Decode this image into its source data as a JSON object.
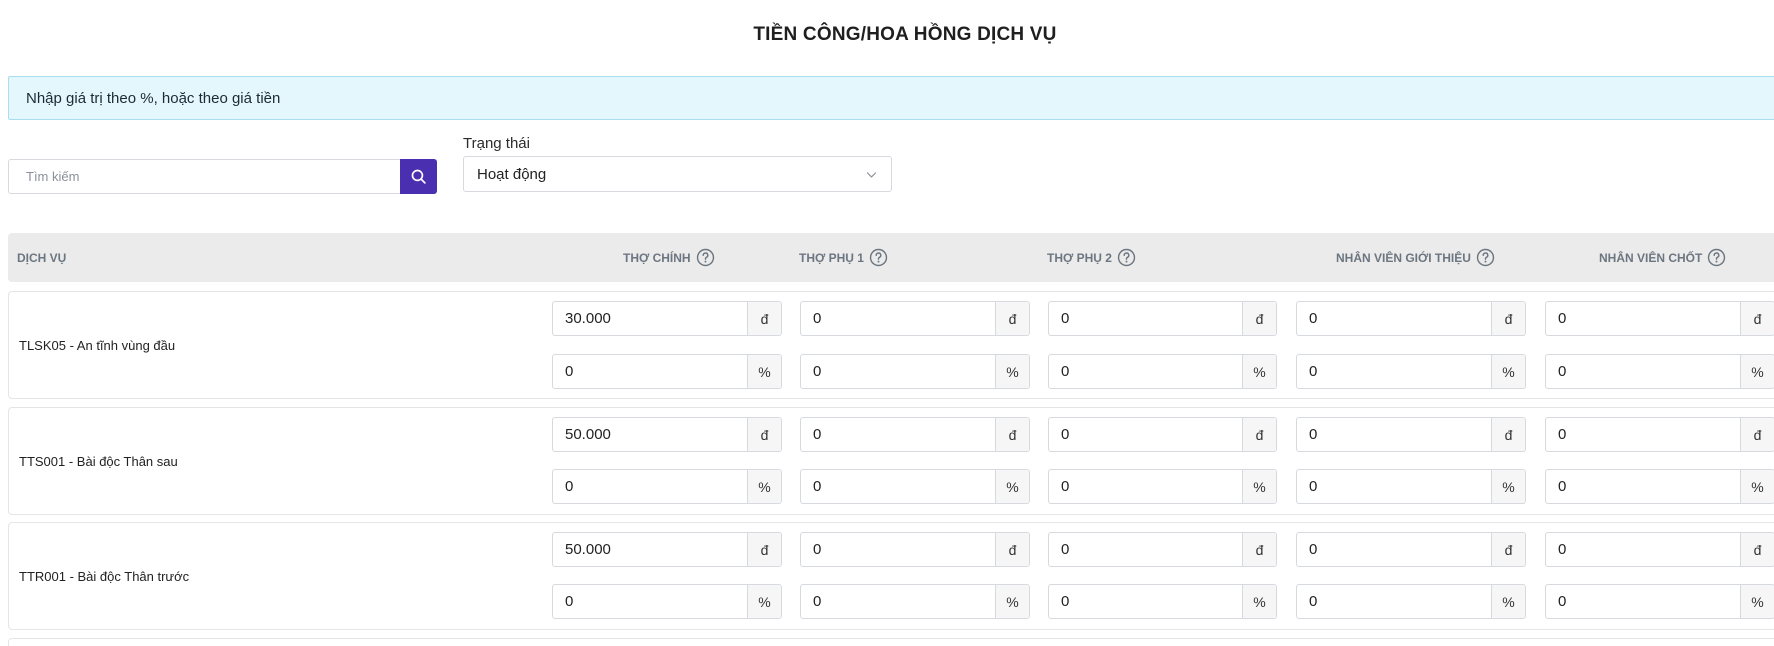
{
  "page": {
    "title": "TIỀN CÔNG/HOA HỒNG DỊCH VỤ",
    "info_text": "Nhập giá trị theo %, hoặc theo giá tiền"
  },
  "search": {
    "placeholder": "Tìm kiếm",
    "value": ""
  },
  "status_filter": {
    "label": "Trạng thái",
    "selected": "Hoạt động"
  },
  "table": {
    "columns": {
      "service": "DỊCH VỤ",
      "main_worker": "THỢ CHÍNH",
      "assistant_1": "THỢ PHỤ 1",
      "assistant_2": "THỢ PHỤ 2",
      "referral_staff": "NHÂN VIÊN GIỚI THIỆU",
      "closing_staff": "NHÂN VIÊN CHỐT"
    },
    "units": {
      "currency": "đ",
      "percent": "%"
    },
    "rows": [
      {
        "name": "TLSK05 - An tĩnh vùng đầu",
        "main_worker": {
          "amount": "30.000",
          "percent": "0"
        },
        "assistant_1": {
          "amount": "0",
          "percent": "0"
        },
        "assistant_2": {
          "amount": "0",
          "percent": "0"
        },
        "referral_staff": {
          "amount": "0",
          "percent": "0"
        },
        "closing_staff": {
          "amount": "0",
          "percent": "0"
        }
      },
      {
        "name": "TTS001 - Bài độc Thân sau",
        "main_worker": {
          "amount": "50.000",
          "percent": "0"
        },
        "assistant_1": {
          "amount": "0",
          "percent": "0"
        },
        "assistant_2": {
          "amount": "0",
          "percent": "0"
        },
        "referral_staff": {
          "amount": "0",
          "percent": "0"
        },
        "closing_staff": {
          "amount": "0",
          "percent": "0"
        }
      },
      {
        "name": "TTR001 - Bài độc Thân trước",
        "main_worker": {
          "amount": "50.000",
          "percent": "0"
        },
        "assistant_1": {
          "amount": "0",
          "percent": "0"
        },
        "assistant_2": {
          "amount": "0",
          "percent": "0"
        },
        "referral_staff": {
          "amount": "0",
          "percent": "0"
        },
        "closing_staff": {
          "amount": "0",
          "percent": "0"
        }
      }
    ]
  },
  "colors": {
    "accent": "#4a2fb0",
    "info_bg": "#e4f7fc",
    "header_bg": "#ebebeb"
  },
  "icons": {
    "search": "search-icon",
    "dropdown": "chevron-down-icon",
    "help": "question-circle-icon"
  }
}
